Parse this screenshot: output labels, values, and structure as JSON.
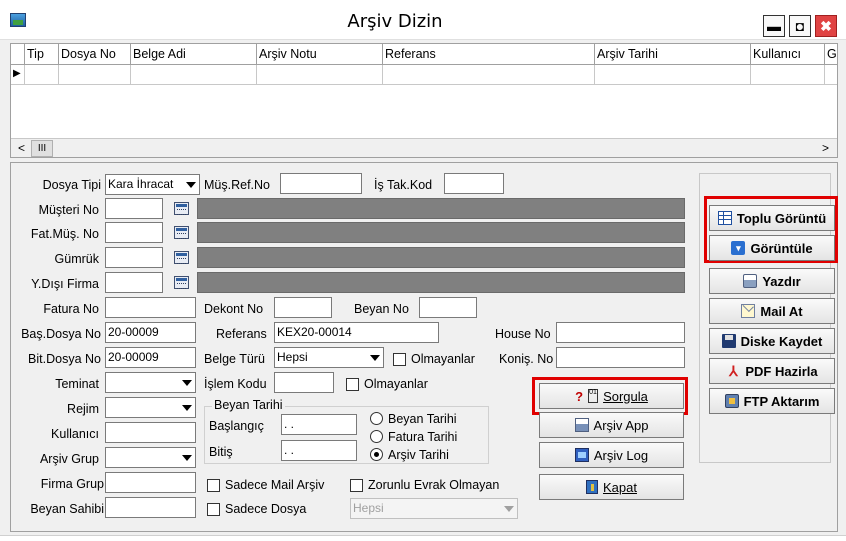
{
  "window": {
    "title": "Arşiv Dizin",
    "minimize": "▬",
    "maximize": "◘",
    "close": "✖"
  },
  "grid": {
    "columns": [
      "Tip",
      "Dosya No",
      "Belge Adi",
      "Arşiv Notu",
      "Referans",
      "Arşiv Tarihi",
      "Kullanıcı",
      "G"
    ],
    "row_indicator": "▶",
    "scroll_left": "<",
    "scroll_thumb": "III",
    "scroll_right": ">"
  },
  "form": {
    "dosya_tipi": {
      "label": "Dosya Tipi",
      "value": "Kara İhracat"
    },
    "mus_ref_no": {
      "label": "Müş.Ref.No",
      "value": ""
    },
    "is_tak_kod": {
      "label": "İş Tak.Kod",
      "value": ""
    },
    "musteri_no": {
      "label": "Müşteri No",
      "value": ""
    },
    "fat_mus_no": {
      "label": "Fat.Müş. No",
      "value": ""
    },
    "gumruk": {
      "label": "Gümrük",
      "value": ""
    },
    "y_disi_firma": {
      "label": "Y.Dışı Firma",
      "value": ""
    },
    "fatura_no": {
      "label": "Fatura No",
      "value": ""
    },
    "dekont_no": {
      "label": "Dekont No",
      "value": ""
    },
    "beyan_no": {
      "label": "Beyan No",
      "value": ""
    },
    "bas_dosya_no": {
      "label": "Baş.Dosya No",
      "value": "20-00009"
    },
    "referans": {
      "label": "Referans",
      "value": "KEX20-00014"
    },
    "house_no": {
      "label": "House No",
      "value": ""
    },
    "bit_dosya_no": {
      "label": "Bit.Dosya No",
      "value": "20-00009"
    },
    "belge_turu": {
      "label": "Belge Türü",
      "value": "Hepsi"
    },
    "olmayanlar_1": {
      "label": "Olmayanlar"
    },
    "konis_no": {
      "label": "Koniş. No",
      "value": ""
    },
    "teminat": {
      "label": "Teminat",
      "value": ""
    },
    "islem_kodu": {
      "label": "İşlem Kodu",
      "value": ""
    },
    "olmayanlar_2": {
      "label": "Olmayanlar"
    },
    "rejim": {
      "label": "Rejim",
      "value": ""
    },
    "beyan_tarihi": {
      "group_label": "Beyan Tarihi",
      "baslangic_label": "Başlangıç",
      "baslangic_value": " . .",
      "bitis_label": "Bitiş",
      "bitis_value": " . .",
      "radio_options": [
        "Beyan Tarihi",
        "Fatura Tarihi",
        "Arşiv Tarihi"
      ],
      "radio_selected": "Arşiv Tarihi"
    },
    "kullanici": {
      "label": "Kullanıcı",
      "value": ""
    },
    "arsiv_grup": {
      "label": "Arşiv Grup",
      "value": ""
    },
    "firma_grup": {
      "label": "Firma Grup",
      "value": ""
    },
    "beyan_sahibi": {
      "label": "Beyan Sahibi",
      "value": ""
    },
    "sadece_mail_arsiv": {
      "label": "Sadece Mail Arşiv"
    },
    "zorunlu_evrak": {
      "label": "Zorunlu Evrak Olmayan"
    },
    "sadece_dosya": {
      "label": "Sadece Dosya"
    },
    "disabled_select": {
      "value": "Hepsi"
    }
  },
  "buttons": {
    "sorgula": "Sorgula",
    "arsiv_app": "Arşiv App",
    "arsiv_log": "Arşiv Log",
    "kapat": "Kapat",
    "toplu_goruntu": "Toplu Görüntü",
    "goruntule": "Görüntüle",
    "yazdir": "Yazdır",
    "mail_at": "Mail At",
    "diske_kaydet": "Diske Kaydet",
    "pdf_hazirla": "PDF Hazirla",
    "ftp_aktarim": "FTP Aktarım"
  },
  "icons": {
    "lookup": "lookup-icon",
    "sorgula_q": "?",
    "sorgula_bin": "01",
    "pdf": "⅄"
  },
  "colors": {
    "highlight": "#e00000",
    "readonly_field": "#808080"
  }
}
